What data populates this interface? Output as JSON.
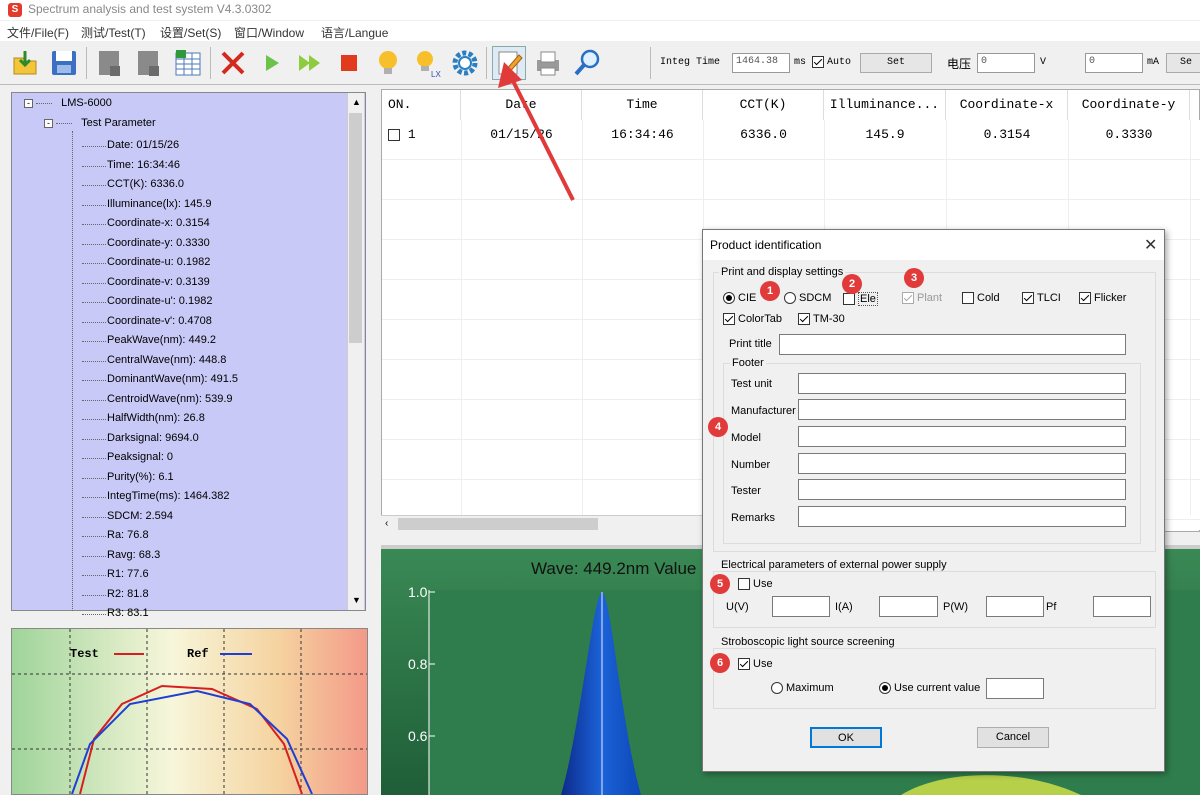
{
  "window": {
    "title": "Spectrum analysis and test system V4.3.0302",
    "icon_letter": "S"
  },
  "menu": [
    "文件/File(F)",
    "测试/Test(T)",
    "设置/Set(S)",
    "窗口/Window",
    "语言/Langue"
  ],
  "toolbar": {
    "buttons": [
      "open-icon",
      "save-icon",
      "doc-gray-icon",
      "doc-gray2-icon",
      "calculator-icon",
      "delete-icon",
      "play-icon",
      "fast-play-icon",
      "stop-icon",
      "bulb-icon",
      "bulb-lx-icon",
      "gear-icon",
      "edit-icon",
      "print-icon",
      "zoom-icon"
    ],
    "integ_label": "Integ Time",
    "integ_value": "1464.38",
    "integ_unit": "ms",
    "auto_label": "Auto",
    "auto_checked": true,
    "set_label": "Set",
    "voltage_label": "电压",
    "voltage_value": "0",
    "voltage_unit": "V",
    "current_value": "0",
    "current_unit": "mA",
    "set2_label": "Se"
  },
  "tree": {
    "root": "LMS-6000",
    "group": "Test Parameter",
    "items": [
      "Date: 01/15/26",
      "Time: 16:34:46",
      "CCT(K): 6336.0",
      "Illuminance(lx): 145.9",
      "Coordinate-x: 0.3154",
      "Coordinate-y: 0.3330",
      "Coordinate-u: 0.1982",
      "Coordinate-v: 0.3139",
      "Coordinate-u': 0.1982",
      "Coordinate-v': 0.4708",
      "PeakWave(nm): 449.2",
      "CentralWave(nm): 448.8",
      "DominantWave(nm): 491.5",
      "CentroidWave(nm): 539.9",
      "HalfWidth(nm): 26.8",
      "Darksignal: 9694.0",
      "Peaksignal: 0",
      "Purity(%): 6.1",
      "IntegTime(ms): 1464.382",
      "SDCM: 2.594",
      "Ra: 76.8",
      "Ravg: 68.3",
      "R1: 77.6",
      "R2: 81.8",
      "R3: 83.1"
    ]
  },
  "cie": {
    "legend_test": "Test",
    "legend_ref": "Ref",
    "test_color": "#d62020",
    "ref_color": "#1d3fd6"
  },
  "table": {
    "columns": [
      "ON.",
      "Date",
      "Time",
      "CCT(K)",
      "Illuminance...",
      "Coordinate-x",
      "Coordinate-y"
    ],
    "rows": [
      [
        "1",
        "01/15/26",
        "16:34:46",
        "6336.0",
        "145.9",
        "0.3154",
        "0.3330"
      ]
    ]
  },
  "spectrum": {
    "title": "Wave: 449.2nm Value",
    "yticks": [
      "1.0",
      "0.8",
      "0.6"
    ],
    "peak_nm": 449.2
  },
  "dialog": {
    "title": "Product identification",
    "print_group": "Print and display settings",
    "options": [
      {
        "label": "CIE",
        "type": "radio",
        "checked": true
      },
      {
        "label": "SDCM",
        "type": "radio",
        "checked": false
      },
      {
        "label": "Ele",
        "type": "check",
        "checked": false
      },
      {
        "label": "Plant",
        "type": "check",
        "checked": true,
        "disabled": true
      },
      {
        "label": "Cold",
        "type": "check",
        "checked": false
      },
      {
        "label": "TLCI",
        "type": "check",
        "checked": true
      },
      {
        "label": "Flicker",
        "type": "check",
        "checked": true
      },
      {
        "label": "ColorTab",
        "type": "check",
        "checked": true
      },
      {
        "label": "TM-30",
        "type": "check",
        "checked": true
      }
    ],
    "print_title_label": "Print title",
    "footer_group": "Footer",
    "footer_fields": [
      "Test unit",
      "Manufacturer",
      "Model",
      "Number",
      "Tester",
      "Remarks"
    ],
    "elec_group": "Electrical parameters of external power supply",
    "elec_use": "Use",
    "elec_fields": [
      "U(V)",
      "I(A)",
      "P(W)",
      "Pf"
    ],
    "strobe_group": "Stroboscopic light source screening",
    "strobe_use": "Use",
    "strobe_maximum": "Maximum",
    "strobe_current": "Use current value",
    "ok": "OK",
    "cancel": "Cancel",
    "markers": [
      "1",
      "2",
      "3",
      "4",
      "5",
      "6"
    ]
  },
  "annotation_color": "#e03a3a"
}
